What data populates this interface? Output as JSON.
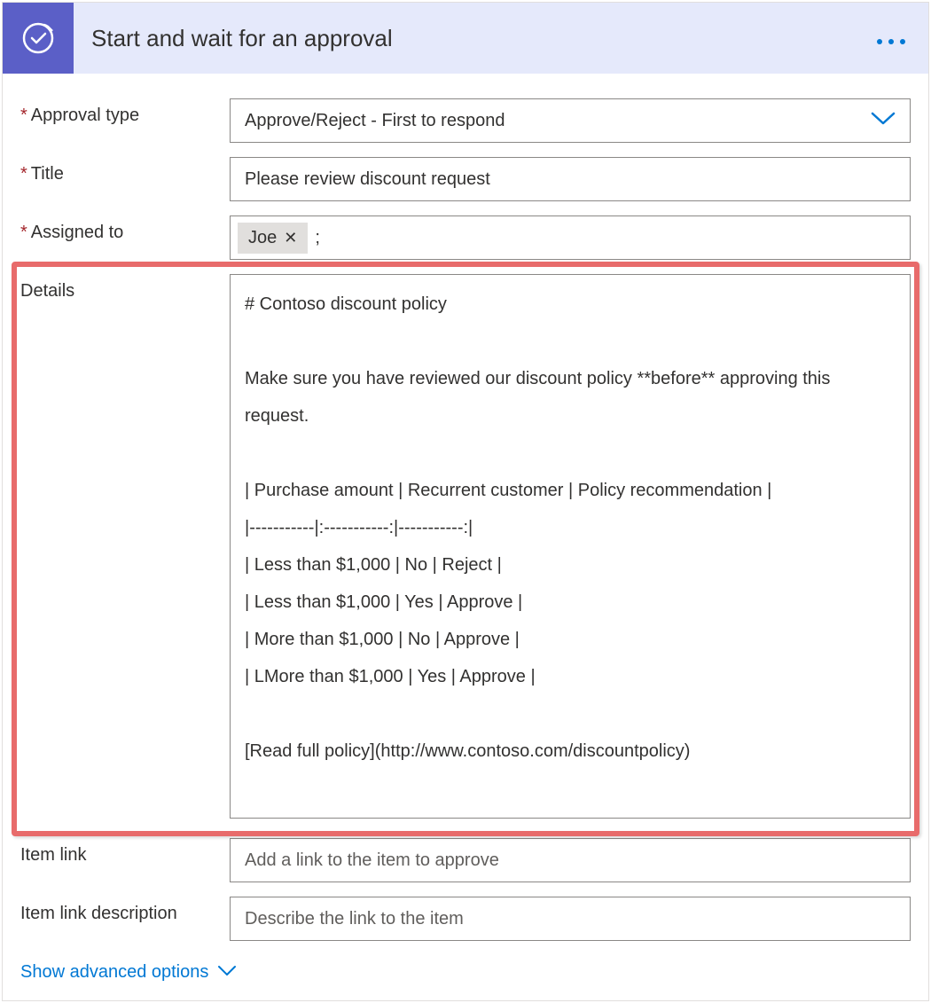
{
  "header": {
    "title": "Start and wait for an approval"
  },
  "fields": {
    "approval_type": {
      "label": "Approval type",
      "value": "Approve/Reject - First to respond"
    },
    "title": {
      "label": "Title",
      "value": "Please review discount request"
    },
    "assigned_to": {
      "label": "Assigned to",
      "pill": "Joe",
      "separator": ";"
    },
    "details": {
      "label": "Details",
      "value": "# Contoso discount policy\n\nMake sure you have reviewed our discount policy **before** approving this request.\n\n| Purchase amount | Recurrent customer | Policy recommendation |\n|-----------|:-----------:|-----------:|\n| Less than $1,000 | No | Reject |\n| Less than $1,000 | Yes | Approve |\n| More than $1,000 | No | Approve |\n| LMore than $1,000 | Yes | Approve |\n\n[Read full policy](http://www.contoso.com/discountpolicy)"
    },
    "item_link": {
      "label": "Item link",
      "placeholder": "Add a link to the item to approve"
    },
    "item_link_description": {
      "label": "Item link description",
      "placeholder": "Describe the link to the item"
    }
  },
  "footer": {
    "advanced": "Show advanced options"
  }
}
